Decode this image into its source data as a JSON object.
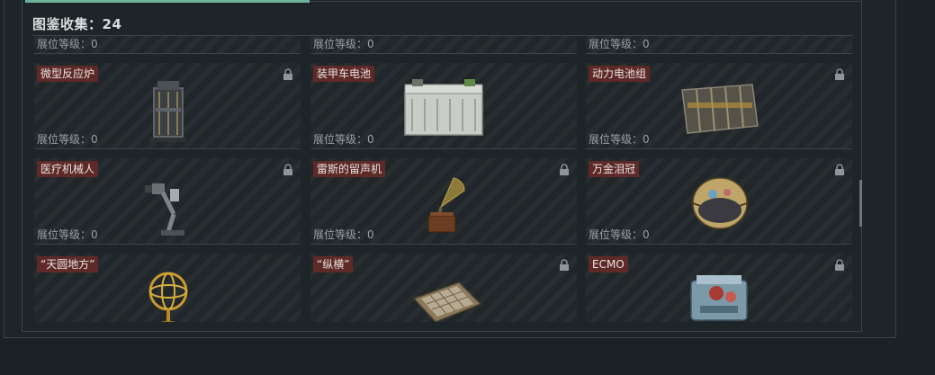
{
  "collection": {
    "header_label": "图鉴收集：24"
  },
  "level_label": "展位等级：",
  "cards": [
    {
      "name": "",
      "level": "0"
    },
    {
      "name": "",
      "level": "0"
    },
    {
      "name": "",
      "level": "0"
    },
    {
      "name": "微型反应炉",
      "level": "0",
      "locked": true
    },
    {
      "name": "装甲车电池",
      "level": "0",
      "locked": false
    },
    {
      "name": "动力电池组",
      "level": "0",
      "locked": true
    },
    {
      "name": "医疗机械人",
      "level": "0",
      "locked": true
    },
    {
      "name": "雷斯的留声机",
      "level": "0",
      "locked": true
    },
    {
      "name": "万金泪冠",
      "level": "0",
      "locked": true
    },
    {
      "name": "“天圆地方”",
      "level": "",
      "locked": false
    },
    {
      "name": "“纵横”",
      "level": "",
      "locked": true
    },
    {
      "name": "ECMO",
      "level": "",
      "locked": true
    }
  ],
  "levels_text": {
    "c0": "展位等级：0",
    "c1": "展位等级：0",
    "c2": "展位等级：0",
    "c3": "展位等级：0",
    "c4": "展位等级：0",
    "c5": "展位等级：0",
    "c6": "展位等级：0",
    "c7": "展位等级：0",
    "c8": "展位等级：0"
  },
  "colors": {
    "accent_tab": "#6db39b",
    "name_tag_bg": "#5e2a28"
  },
  "icons": {
    "lock": "lock-icon"
  }
}
